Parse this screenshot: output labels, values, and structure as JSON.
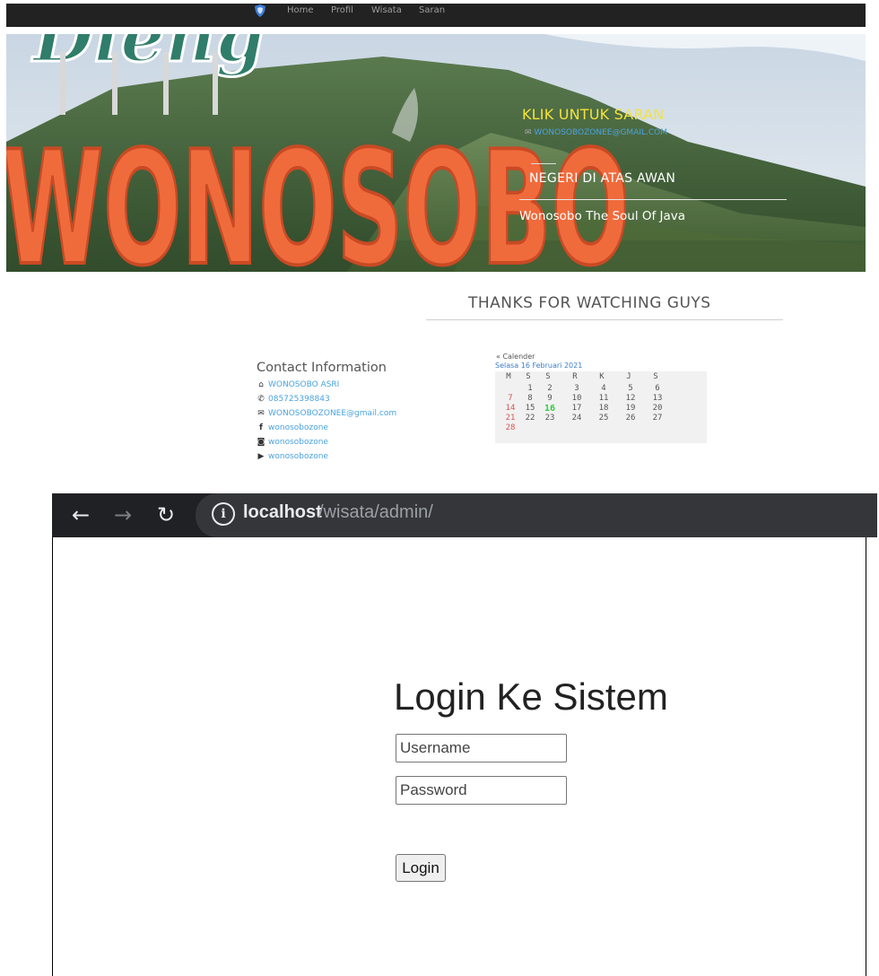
{
  "nav": {
    "logo_icon": "shield-icon",
    "links": [
      "Home",
      "Profil",
      "Wisata",
      "Saran"
    ]
  },
  "hero": {
    "sign_text": "WONOSOBO",
    "sign_script_text": "Dieng",
    "saran_label": "KLIK UNTUK SARAN",
    "saran_email": "WONOSOBOZONEE@GMAIL.COM",
    "tagline": "NEGERI DI ATAS AWAN",
    "subtitle": "Wonosobo The Soul Of Java"
  },
  "thanks": "THANKS FOR WATCHING GUYS",
  "contact": {
    "title": "Contact Information",
    "items": [
      {
        "icon": "home-icon",
        "text": "WONOSOBO ASRI"
      },
      {
        "icon": "phone-icon",
        "text": "085725398843"
      },
      {
        "icon": "mail-icon",
        "text": "WONOSOBOZONEE@gmail.com"
      },
      {
        "icon": "facebook-icon",
        "text": "wonosobozone"
      },
      {
        "icon": "instagram-icon",
        "text": "wonosobozone"
      },
      {
        "icon": "youtube-icon",
        "text": "wonosobozone"
      }
    ]
  },
  "calendar": {
    "header": "« Calender",
    "date_label": "Selasa 16 Februari 2021",
    "weekdays": [
      "M",
      "S",
      "S",
      "R",
      "K",
      "J",
      "S"
    ],
    "weeks": [
      [
        "",
        "1",
        "2",
        "3",
        "4",
        "5",
        "6"
      ],
      [
        "7",
        "8",
        "9",
        "10",
        "11",
        "12",
        "13"
      ],
      [
        "14",
        "15",
        "16",
        "17",
        "18",
        "19",
        "20"
      ],
      [
        "21",
        "22",
        "23",
        "24",
        "25",
        "26",
        "27"
      ],
      [
        "28",
        "",
        "",
        "",
        "",
        "",
        ""
      ]
    ],
    "today": "16",
    "colors": {
      "sunday": "#d9534f",
      "today": "#2ecc40"
    }
  },
  "browser": {
    "url_host": "localhost",
    "url_path": "/wisata/admin/",
    "icons": [
      "back-arrow-icon",
      "forward-arrow-icon",
      "reload-icon",
      "info-icon"
    ]
  },
  "login": {
    "title": "Login Ke Sistem",
    "username_placeholder": "Username",
    "password_placeholder": "Password",
    "button_label": "Login"
  }
}
